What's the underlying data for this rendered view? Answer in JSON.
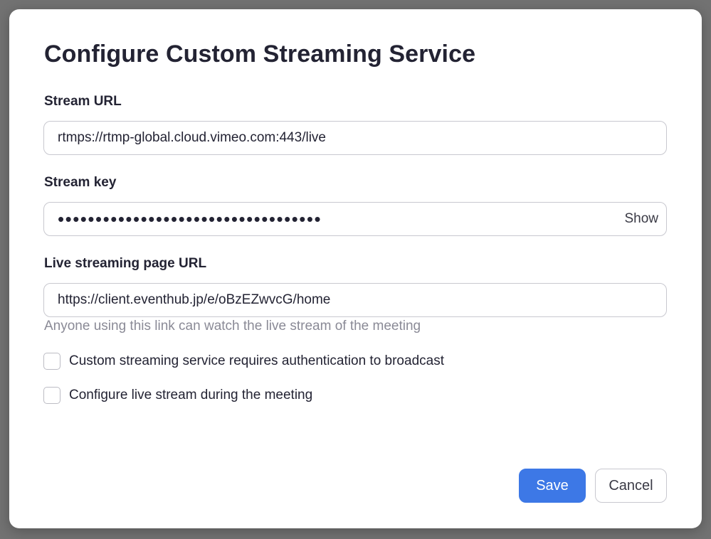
{
  "dialog": {
    "title": "Configure Custom Streaming Service"
  },
  "stream_url": {
    "label": "Stream URL",
    "value": "rtmps://rtmp-global.cloud.vimeo.com:443/live"
  },
  "stream_key": {
    "label": "Stream key",
    "masked_value": "•••••••••••••••••••••••••••••••••••",
    "show_label": "Show"
  },
  "live_page_url": {
    "label": "Live streaming page URL",
    "value": "https://client.eventhub.jp/e/oBzEZwvcG/home",
    "hint": "Anyone using this link can watch the live stream of the meeting"
  },
  "options": [
    {
      "label": "Custom streaming service requires authentication to broadcast",
      "checked": false
    },
    {
      "label": "Configure live stream during the meeting",
      "checked": false
    }
  ],
  "buttons": {
    "save_label": "Save",
    "cancel_label": "Cancel"
  },
  "colors": {
    "primary": "#3d78e6",
    "text": "#232333",
    "hint": "#8a8a96",
    "border": "#c8c8cf"
  }
}
